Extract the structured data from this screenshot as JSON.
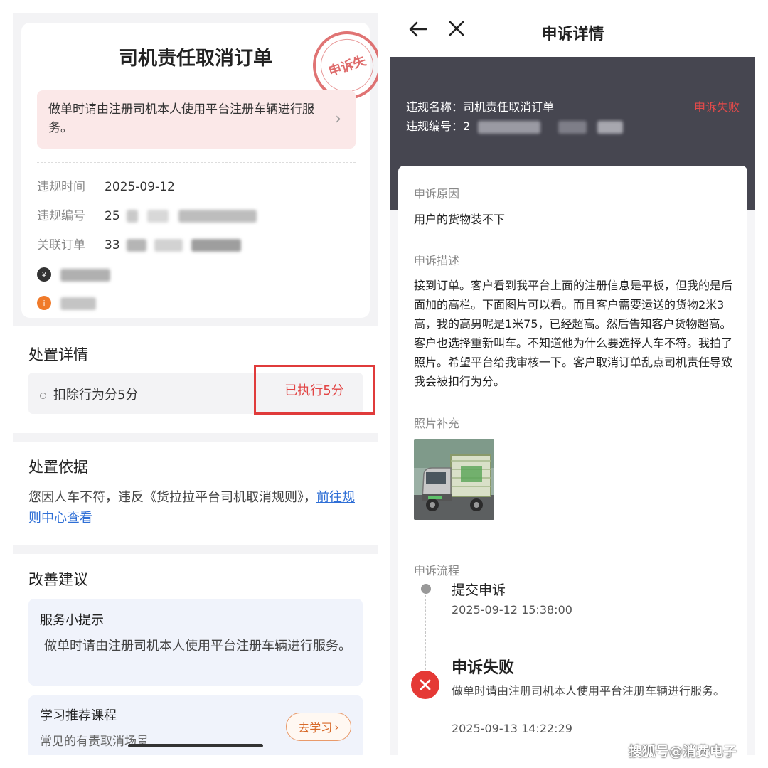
{
  "left": {
    "title": "司机责任取消订单",
    "stamp": "申诉失",
    "notice": "做单时请由注册司机本人使用平台注册车辆进行服务。",
    "rows": [
      {
        "label": "违规时间",
        "value": "2025-09-12"
      },
      {
        "label": "违规编号",
        "value": "25"
      },
      {
        "label": "关联订单",
        "value": "33"
      }
    ],
    "handling": {
      "title": "处置详情",
      "item": "扣除行为分5分",
      "status": "已执行5分"
    },
    "basis": {
      "title": "处置依据",
      "text": "您因人车不符，违反《货拉拉平台司机取消规则》，",
      "link": "前往规则中心查看"
    },
    "advice": {
      "title": "改善建议",
      "tip_title": "服务小提示",
      "tip_body": "做单时请由注册司机本人使用平台注册车辆进行服务。",
      "course_title": "学习推荐课程",
      "course_sub": "常见的有责取消场景",
      "course_button": "去学习"
    }
  },
  "right": {
    "header_title": "申诉详情",
    "violation_name_label": "违规名称：",
    "violation_name": "司机责任取消订单",
    "violation_id_label": "违规编号：",
    "violation_id": "2",
    "status": "申诉失败",
    "reason_label": "申诉原因",
    "reason": "用户的货物装不下",
    "desc_label": "申诉描述",
    "description": "接到订单。客户看到我平台上面的注册信息是平板，但我的是后面加的高栏。下面图片可以看。而且客户需要运送的货物2米3高，我的高男呢是1米75，已经超高。然后告知客户货物超高。客户也选择重新叫车。不知道他为什么要选择人车不符。我拍了照片。希望平台给我审核一下。客户取消订单乱点司机责任导致我会被扣行为分。",
    "photo_label": "照片补充",
    "flow_label": "申诉流程",
    "flow": [
      {
        "title": "提交申诉",
        "time": "2025-09-12 15:38:00"
      },
      {
        "title": "申诉失败",
        "desc": "做单时请由注册司机本人使用平台注册车辆进行服务。",
        "time": "2025-09-13 14:22:29"
      }
    ]
  },
  "credit": "搜狐号@消费电子",
  "colors": {
    "accent_red": "#e53935",
    "banner": "#464650",
    "link": "#2f6fd6"
  }
}
